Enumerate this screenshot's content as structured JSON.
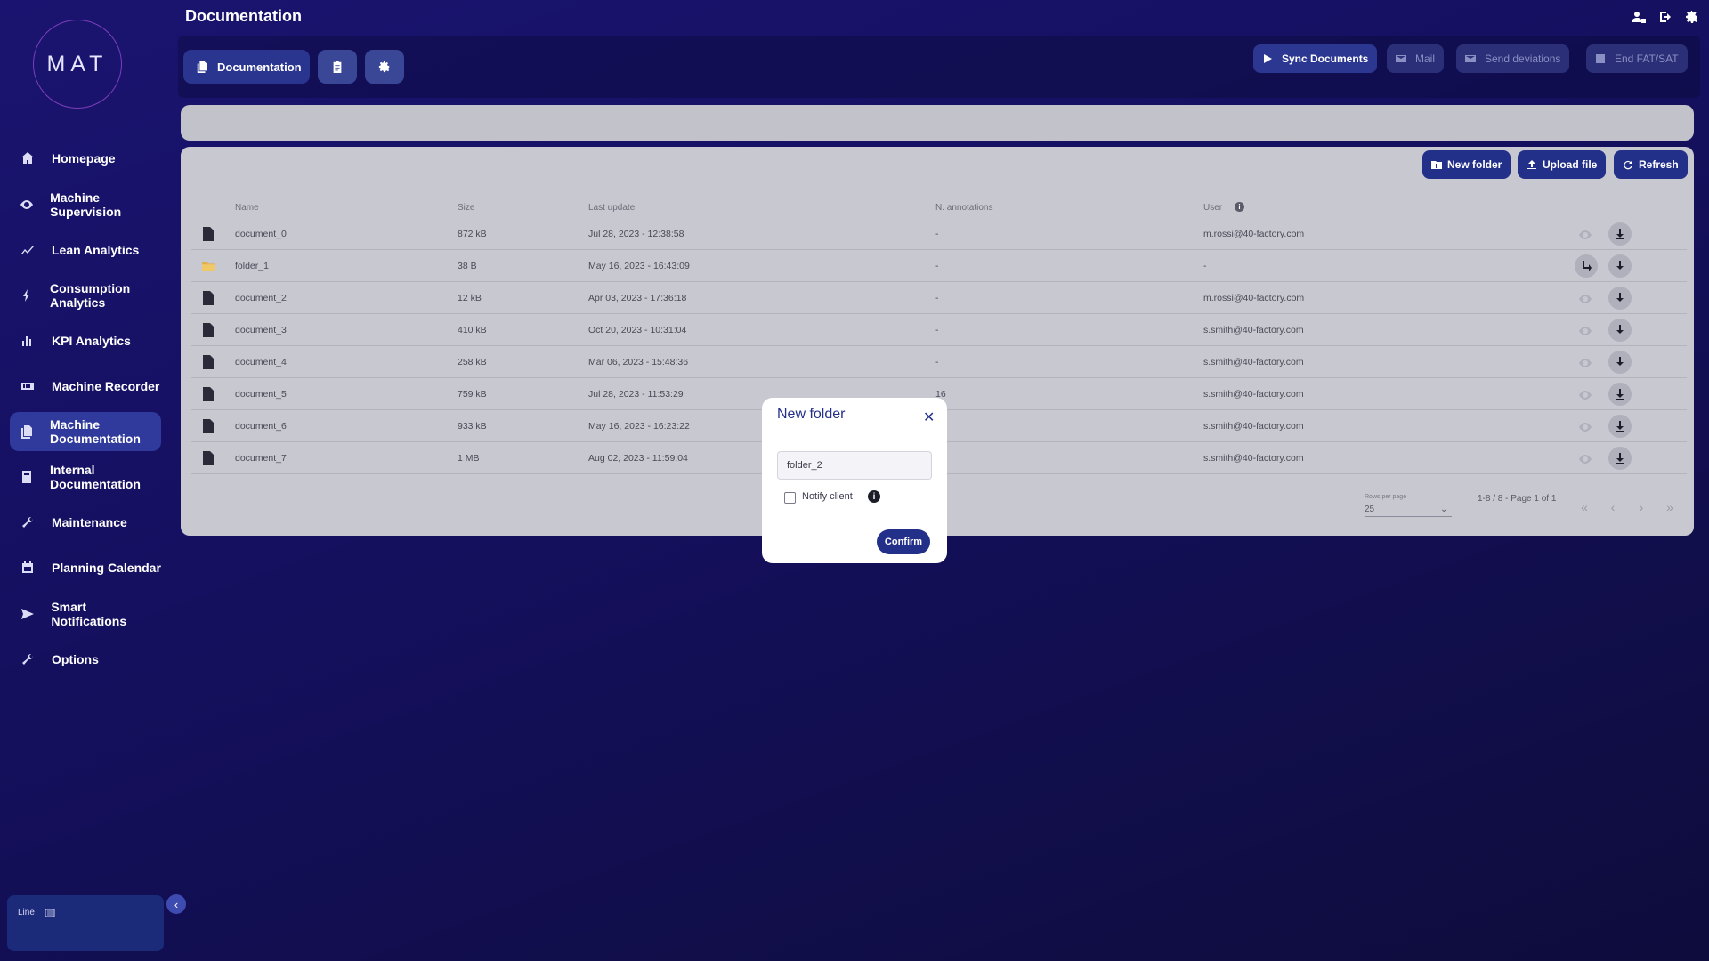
{
  "sidebar": {
    "logo": "MAT",
    "items": [
      {
        "label": "Homepage",
        "icon": "home-icon"
      },
      {
        "label": "Machine Supervision",
        "icon": "eye-icon"
      },
      {
        "label": "Lean Analytics",
        "icon": "trend-icon"
      },
      {
        "label": "Consumption Analytics",
        "icon": "bolt-icon"
      },
      {
        "label": "KPI Analytics",
        "icon": "bar-chart-icon"
      },
      {
        "label": "Machine Recorder",
        "icon": "recorder-icon"
      },
      {
        "label": "Machine Documentation",
        "icon": "document-copy-icon",
        "active": true
      },
      {
        "label": "Internal Documentation",
        "icon": "book-icon"
      },
      {
        "label": "Maintenance",
        "icon": "wrench-icon"
      },
      {
        "label": "Planning Calendar",
        "icon": "calendar-icon"
      },
      {
        "label": "Smart Notifications",
        "icon": "send-icon"
      },
      {
        "label": "Options",
        "icon": "wrench-icon"
      }
    ],
    "line_label": "Line"
  },
  "header": {
    "title": "Documentation",
    "tab_documentation": "Documentation",
    "actions": {
      "sync": "Sync Documents",
      "mail": "Mail",
      "send_deviations": "Send deviations",
      "end_fat": "End FAT/SAT"
    }
  },
  "card": {
    "new_folder": "New folder",
    "upload_file": "Upload file",
    "refresh": "Refresh",
    "columns": {
      "name": "Name",
      "size": "Size",
      "last_update": "Last update",
      "annotations": "N. annotations",
      "user": "User"
    },
    "rows": [
      {
        "name": "document_0",
        "size": "872 kB",
        "last_update": "Jul 28, 2023 - 12:38:58",
        "annotations": "-",
        "user": "m.rossi@40-factory.com",
        "type": "file"
      },
      {
        "name": "folder_1",
        "size": "38 B",
        "last_update": "May 16, 2023 - 16:43:09",
        "annotations": "-",
        "user": "-",
        "type": "folder"
      },
      {
        "name": "document_2",
        "size": "12 kB",
        "last_update": "Apr 03, 2023 - 17:36:18",
        "annotations": "-",
        "user": "m.rossi@40-factory.com",
        "type": "file"
      },
      {
        "name": "document_3",
        "size": "410 kB",
        "last_update": "Oct 20, 2023 - 10:31:04",
        "annotations": "-",
        "user": "s.smith@40-factory.com",
        "type": "file"
      },
      {
        "name": "document_4",
        "size": "258 kB",
        "last_update": "Mar 06, 2023 - 15:48:36",
        "annotations": "-",
        "user": "s.smith@40-factory.com",
        "type": "file"
      },
      {
        "name": "document_5",
        "size": "759 kB",
        "last_update": "Jul 28, 2023 - 11:53:29",
        "annotations": "16",
        "user": "s.smith@40-factory.com",
        "type": "file"
      },
      {
        "name": "document_6",
        "size": "933 kB",
        "last_update": "May 16, 2023 - 16:23:22",
        "annotations": "",
        "user": "s.smith@40-factory.com",
        "type": "file"
      },
      {
        "name": "document_7",
        "size": "1 MB",
        "last_update": "Aug 02, 2023 - 11:59:04",
        "annotations": "",
        "user": "s.smith@40-factory.com",
        "type": "file"
      }
    ],
    "rows_per_page_label": "Rows per page",
    "rows_per_page": "25",
    "pagination": "1-8 / 8 - Page 1 of 1"
  },
  "dialog": {
    "title": "New folder",
    "input_value": "folder_2",
    "notify_label": "Notify client",
    "confirm": "Confirm"
  },
  "colors": {
    "background": "#151060",
    "accent": "#23308a",
    "card": "#c8c8d0"
  }
}
